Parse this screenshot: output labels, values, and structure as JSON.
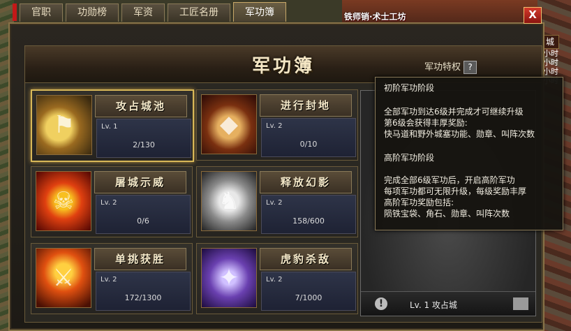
{
  "tabs": [
    {
      "label": "官职",
      "active": false
    },
    {
      "label": "功勋榜",
      "active": false
    },
    {
      "label": "军资",
      "active": false
    },
    {
      "label": "工匠名册",
      "active": false
    },
    {
      "label": "军功簿",
      "active": true
    }
  ],
  "close_label": "X",
  "background": {
    "banner": "铁师销·术士工坊",
    "city_label": "城",
    "side_lines": [
      "小时",
      "小时",
      "小时",
      "小时"
    ]
  },
  "panel": {
    "title": "军功簿",
    "privilege_label": "军功特权",
    "help_label": "?"
  },
  "cards": [
    {
      "name": "攻占城池",
      "level": "Lv. 1",
      "progress": "2/130",
      "icon": "flag-scroll-icon",
      "selected": true
    },
    {
      "name": "进行封地",
      "level": "Lv. 2",
      "progress": "0/10",
      "icon": "seal-icon",
      "selected": false
    },
    {
      "name": "屠城示威",
      "level": "Lv. 2",
      "progress": "0/6",
      "icon": "fire-warrior-icon",
      "selected": false
    },
    {
      "name": "释放幻影",
      "level": "Lv. 2",
      "progress": "158/600",
      "icon": "phantom-horse-icon",
      "selected": false
    },
    {
      "name": "单挑获胜",
      "level": "Lv. 2",
      "progress": "172/1300",
      "icon": "duel-icon",
      "selected": false
    },
    {
      "name": "虎豹杀敌",
      "level": "Lv. 2",
      "progress": "7/1000",
      "icon": "blades-icon",
      "selected": false
    }
  ],
  "detail": {
    "label": "Lv. 1 攻占城"
  },
  "tooltip": {
    "basic_title": "初阶军功阶段",
    "basic_lines": [
      "全部军功到达6级并完成才可继续升级",
      "第6级会获得丰厚奖励:",
      "快马道和野外城塞功能、勋章、叫阵次数"
    ],
    "advanced_title": "高阶军功阶段",
    "advanced_lines": [
      "完成全部6级军功后，开启高阶军功",
      "每项军功都可无限升级，每级奖励丰厚",
      "高阶军功奖励包括:",
      "陨铁宝袋、角石、勋章、叫阵次数"
    ]
  }
}
